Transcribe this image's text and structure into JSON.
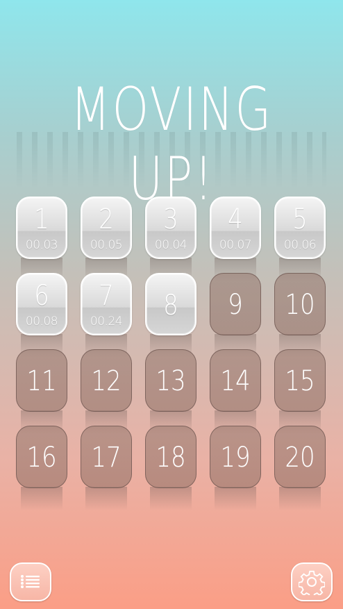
{
  "title": "MOVING UP!",
  "levels": [
    {
      "number": "1",
      "time": "00.03",
      "state": "completed"
    },
    {
      "number": "2",
      "time": "00.05",
      "state": "completed"
    },
    {
      "number": "3",
      "time": "00.04",
      "state": "completed"
    },
    {
      "number": "4",
      "time": "00.07",
      "state": "completed"
    },
    {
      "number": "5",
      "time": "00.06",
      "state": "completed"
    },
    {
      "number": "6",
      "time": "00.08",
      "state": "completed"
    },
    {
      "number": "7",
      "time": "00.24",
      "state": "completed"
    },
    {
      "number": "8",
      "state": "unlocked"
    },
    {
      "number": "9",
      "state": "locked"
    },
    {
      "number": "10",
      "state": "locked"
    },
    {
      "number": "11",
      "state": "locked"
    },
    {
      "number": "12",
      "state": "locked"
    },
    {
      "number": "13",
      "state": "locked"
    },
    {
      "number": "14",
      "state": "locked"
    },
    {
      "number": "15",
      "state": "locked"
    },
    {
      "number": "16",
      "state": "locked"
    },
    {
      "number": "17",
      "state": "locked"
    },
    {
      "number": "18",
      "state": "locked"
    },
    {
      "number": "19",
      "state": "locked"
    },
    {
      "number": "20",
      "state": "locked"
    }
  ],
  "buttons": {
    "menu_icon": "list-icon",
    "settings_icon": "gear-icon"
  },
  "colors": {
    "top": "#8fe6ec",
    "bottom": "#fb9e86",
    "tile_locked_border": "#6e5550"
  }
}
